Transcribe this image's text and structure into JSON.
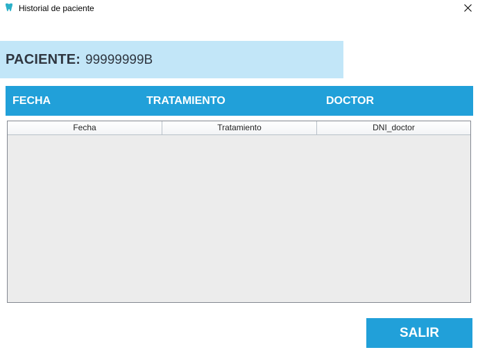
{
  "window": {
    "title": "Historial de paciente",
    "icon": "tooth-icon",
    "close_icon": "close-icon"
  },
  "patient": {
    "label": "PACIENTE:",
    "value": "99999999B"
  },
  "section_header": {
    "fecha": "FECHA",
    "tratamiento": "TRATAMIENTO",
    "doctor": "DOCTOR"
  },
  "table": {
    "columns": [
      "Fecha",
      "Tratamiento",
      "DNI_doctor"
    ],
    "rows": []
  },
  "actions": {
    "exit_label": "SALIR"
  },
  "colors": {
    "accent": "#21a0d9",
    "panel": "#c2e6f8",
    "table_bg": "#ececec"
  }
}
